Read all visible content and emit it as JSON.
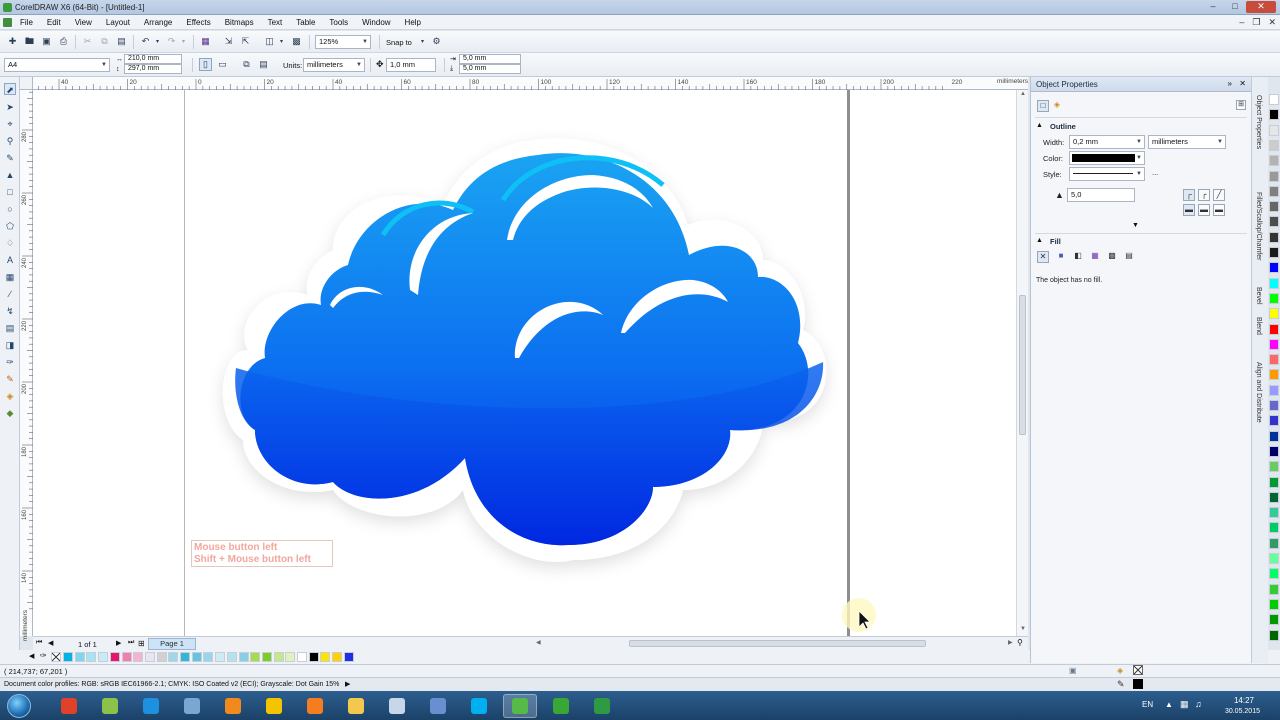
{
  "window": {
    "title": "CorelDRAW X6 (64-Bit) - [Untitled-1]"
  },
  "menu": [
    "File",
    "Edit",
    "View",
    "Layout",
    "Arrange",
    "Effects",
    "Bitmaps",
    "Text",
    "Table",
    "Tools",
    "Window",
    "Help"
  ],
  "standard_toolbar": {
    "zoom": "125%",
    "snap_to": "Snap to"
  },
  "property_bar": {
    "page_size": "A4",
    "width": "210,0 mm",
    "height": "297,0 mm",
    "units_label": "Units:",
    "units_value": "millimeters",
    "nudge": "1,0 mm",
    "dup_x": "5,0 mm",
    "dup_y": "5,0 mm"
  },
  "ruler": {
    "h_labels": [
      "40",
      "20",
      "0",
      "20",
      "40",
      "60",
      "80",
      "100",
      "120",
      "140",
      "160",
      "180",
      "200",
      "220",
      "240"
    ],
    "h_unit": "millimeters",
    "v_labels": [
      "280",
      "260",
      "240",
      "220",
      "200",
      "180",
      "160",
      "140",
      "120",
      "100",
      "80"
    ],
    "v_unit": "millimeters"
  },
  "canvas": {
    "hint_line1": "Mouse button left",
    "hint_line2": "Shift + Mouse button left"
  },
  "page_nav": {
    "counter": "1 of 1",
    "page_tab": "Page 1"
  },
  "palette": {
    "colors": [
      "#00b4e6",
      "#7fd6f0",
      "#a6e3f5",
      "#c7ecf8",
      "#e4156d",
      "#f07fb0",
      "#f6b3d0",
      "#e9e4f3",
      "#d1d1d1",
      "#9fd7ea",
      "#33b5d9",
      "#66c4e3",
      "#99d6eb",
      "#ccebf5",
      "#b5e2ef",
      "#86cfe6",
      "#a6dc4a",
      "#7ccd2a",
      "#c6e88a",
      "#dff2c0",
      "#ffffff",
      "#000000",
      "#ffe400",
      "#ffd100",
      "#1f2fe5"
    ],
    "vertical_colors": [
      "#ffffff",
      "#000000",
      "#e6e6e6",
      "#cccccc",
      "#b3b3b3",
      "#999999",
      "#808080",
      "#666666",
      "#4d4d4d",
      "#333333",
      "#1a1a1a",
      "#0000ff",
      "#00ffff",
      "#00ff00",
      "#ffff00",
      "#ff0000",
      "#ff00ff",
      "#ff6666",
      "#ff9900",
      "#9999ff",
      "#6666cc",
      "#3333cc",
      "#003399",
      "#000066",
      "#66cc66",
      "#009933",
      "#006633",
      "#33cc99",
      "#00cc66",
      "#339966",
      "#66ff99",
      "#00ff66",
      "#33cc33",
      "#00cc00",
      "#009900",
      "#006600"
    ]
  },
  "docker": {
    "title": "Object Properties",
    "outline": {
      "heading": "Outline",
      "width_label": "Width:",
      "width_value": "0,2 mm",
      "width_unit": "millimeters",
      "color_label": "Color:",
      "color_value": "#000000",
      "style_label": "Style:",
      "style_more": "...",
      "miter_value": "5,0"
    },
    "fill": {
      "heading": "Fill",
      "status": "The object has no fill."
    },
    "tabs": [
      "Object Properties",
      "Fillet/Scallop/Chamfer",
      "Bevel",
      "Blend",
      "Align and Distribute"
    ]
  },
  "status": {
    "coordinates": "( 214,737; 67,201 )",
    "color_profiles": "Document color profiles: RGB: sRGB IEC61966-2.1; CMYK: ISO Coated v2 (ECI); Grayscale: Dot Gain 15%"
  },
  "taskbar": {
    "language": "EN",
    "time": "14:27",
    "date": "30.05.2015",
    "apps": [
      {
        "name": "chrome",
        "color": "#e0412a"
      },
      {
        "name": "android",
        "color": "#8cc24a"
      },
      {
        "name": "internet-explorer",
        "color": "#1e90e0"
      },
      {
        "name": "network",
        "color": "#7aa7d1"
      },
      {
        "name": "media-player",
        "color": "#f08a1c"
      },
      {
        "name": "1c",
        "color": "#f5c400"
      },
      {
        "name": "firefox",
        "color": "#f57c1f"
      },
      {
        "name": "explorer",
        "color": "#f2c94c"
      },
      {
        "name": "notepad",
        "color": "#c8d6ea"
      },
      {
        "name": "calculator",
        "color": "#6a8fd1"
      },
      {
        "name": "skype",
        "color": "#00aff0"
      },
      {
        "name": "coreldraw",
        "color": "#57b947"
      },
      {
        "name": "camtasia",
        "color": "#3aa635"
      },
      {
        "name": "corel-connect",
        "color": "#2e9a43"
      }
    ]
  }
}
